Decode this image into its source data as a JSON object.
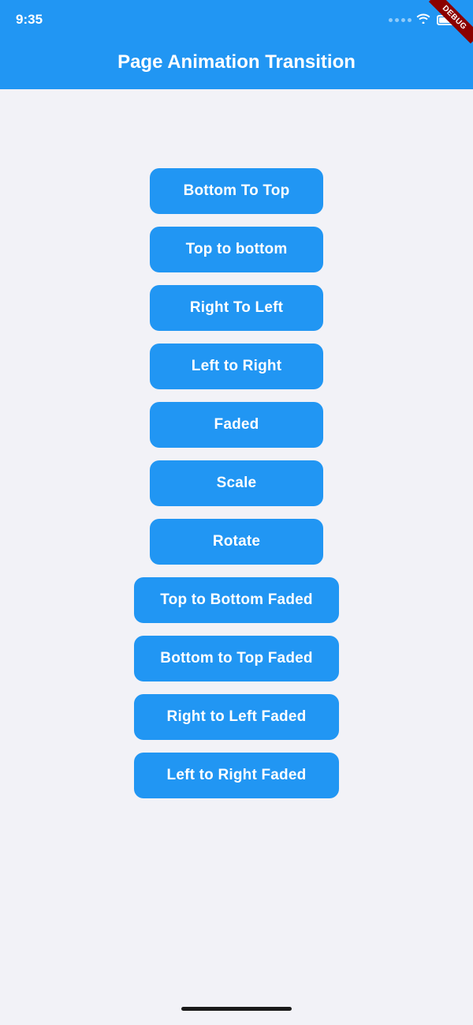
{
  "statusBar": {
    "time": "9:35",
    "debugLabel": "DEBUG"
  },
  "header": {
    "title": "Page Animation Transition"
  },
  "buttons": [
    {
      "id": "bottom-to-top",
      "label": "Bottom To Top",
      "wide": false
    },
    {
      "id": "top-to-bottom",
      "label": "Top to bottom",
      "wide": false
    },
    {
      "id": "right-to-left",
      "label": "Right To Left",
      "wide": false
    },
    {
      "id": "left-to-right",
      "label": "Left to Right",
      "wide": false
    },
    {
      "id": "faded",
      "label": "Faded",
      "wide": false
    },
    {
      "id": "scale",
      "label": "Scale",
      "wide": false
    },
    {
      "id": "rotate",
      "label": "Rotate",
      "wide": false
    },
    {
      "id": "top-to-bottom-faded",
      "label": "Top to Bottom Faded",
      "wide": true
    },
    {
      "id": "bottom-to-top-faded",
      "label": "Bottom to Top Faded",
      "wide": true
    },
    {
      "id": "right-to-left-faded",
      "label": "Right to Left Faded",
      "wide": true
    },
    {
      "id": "left-to-right-faded",
      "label": "Left to Right Faded",
      "wide": true
    }
  ],
  "colors": {
    "primary": "#2196f3",
    "header_bg": "#2196f3",
    "page_bg": "#f2f2f7",
    "debug_bg": "#8b0000"
  }
}
